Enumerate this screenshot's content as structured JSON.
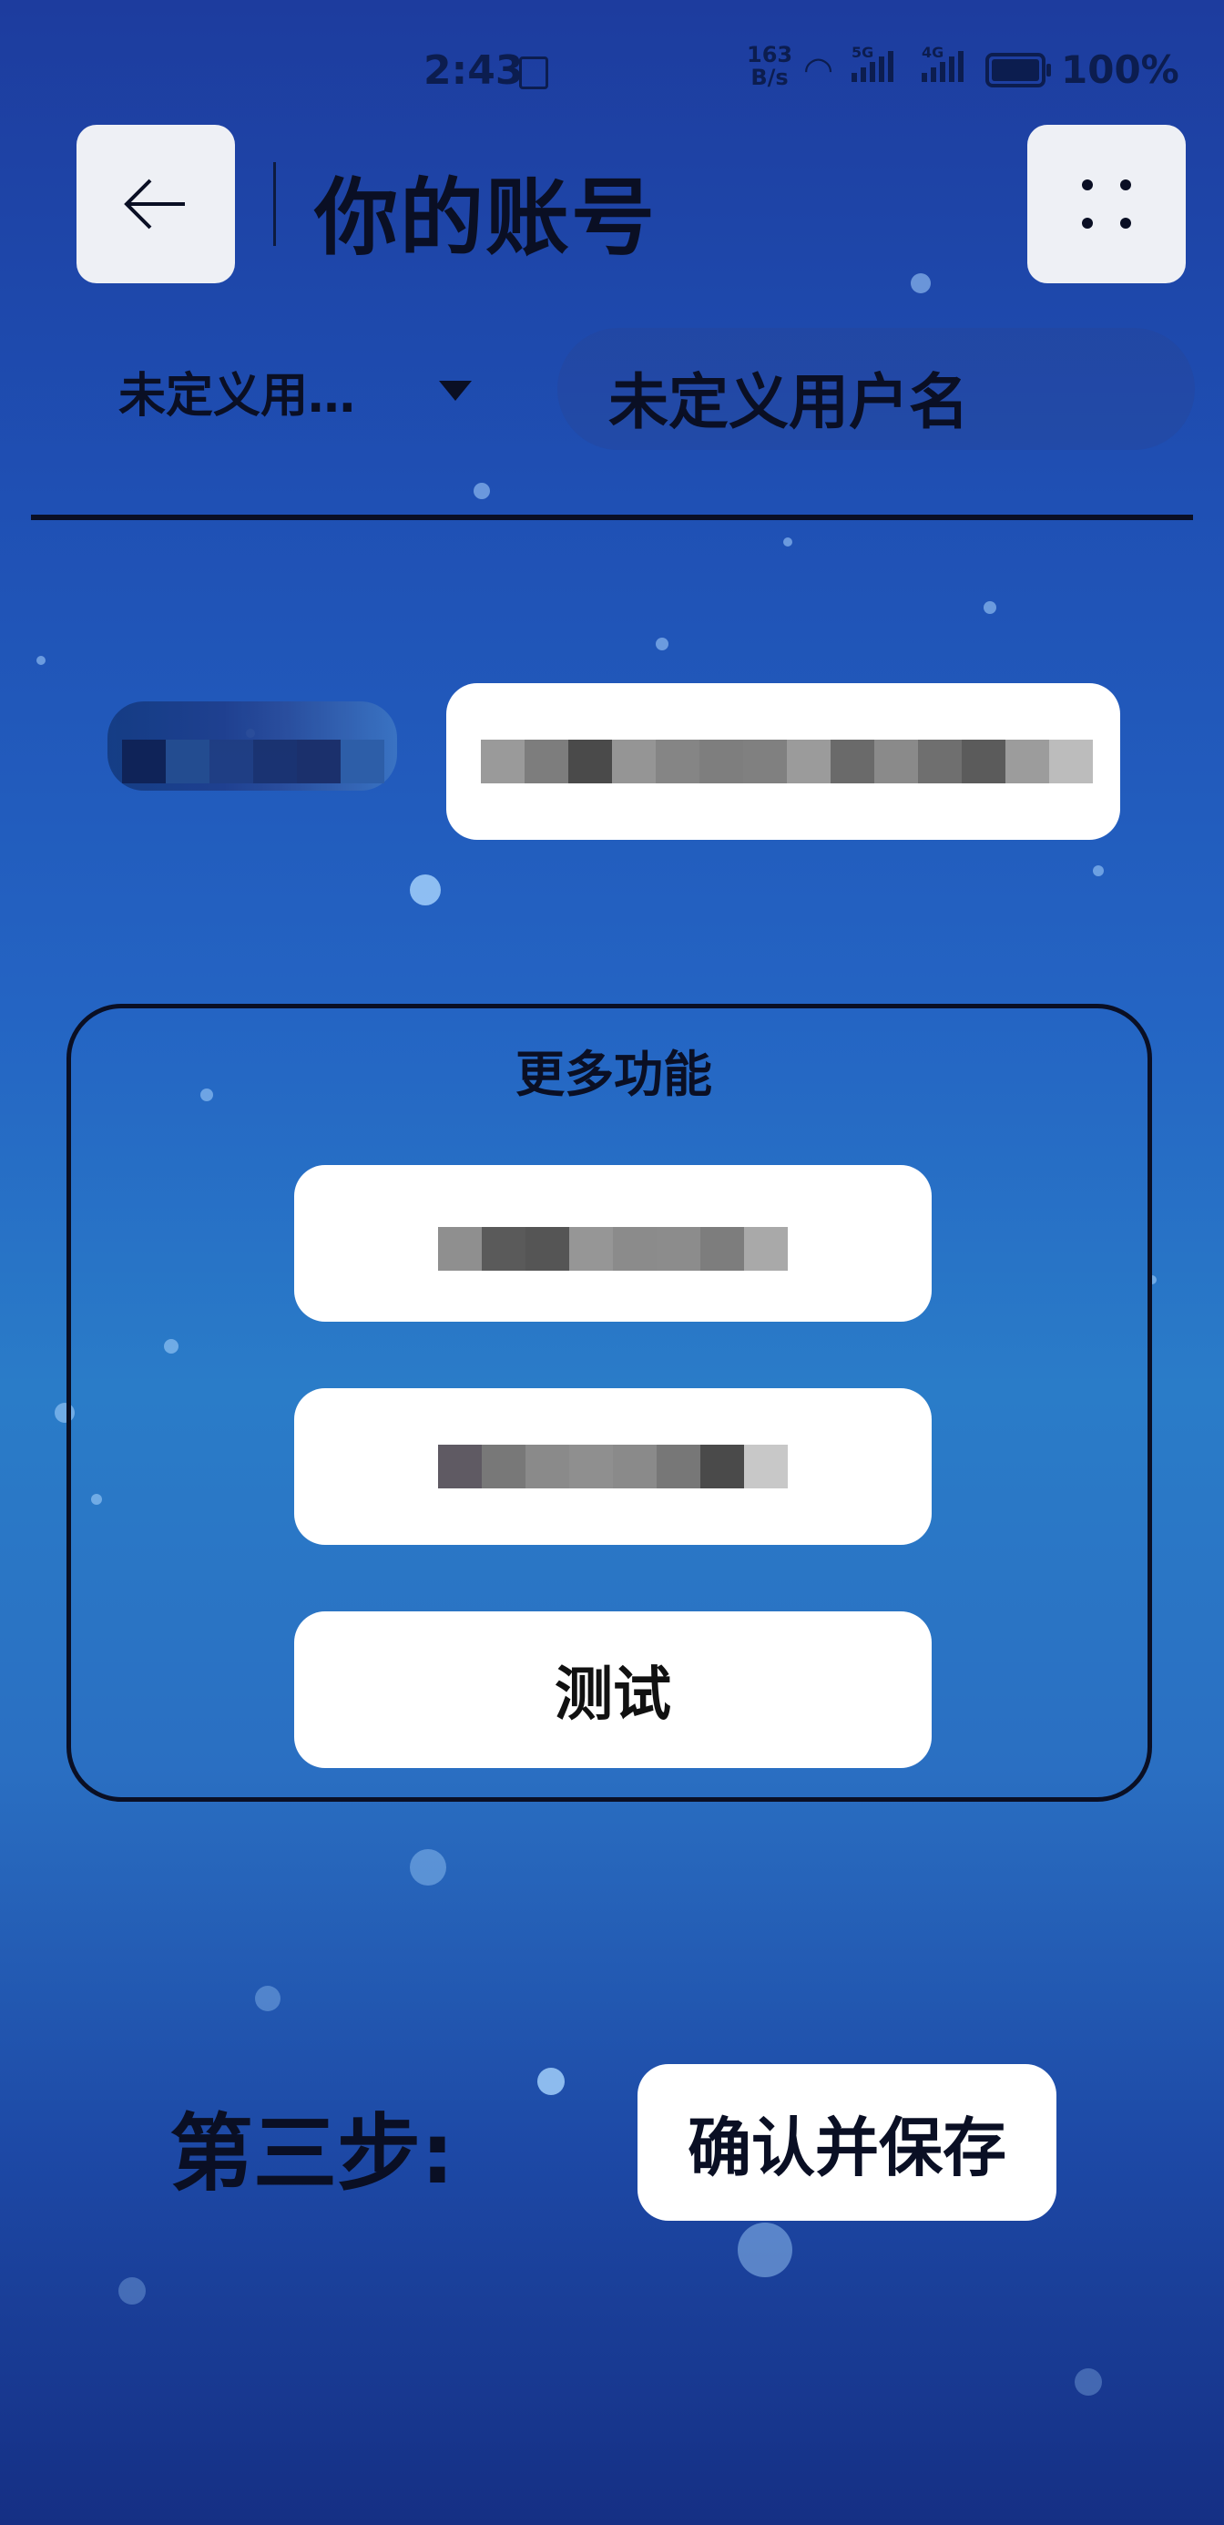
{
  "status_bar": {
    "time": "2:43",
    "net_speed_value": "163",
    "net_speed_unit": "B/s",
    "signal1_tag": "5G",
    "signal2_tag": "4G",
    "battery": "100%"
  },
  "header": {
    "back_icon": "arrow-left-icon",
    "title": "你的账号",
    "menu_icon": "four-dots-icon"
  },
  "user": {
    "selected_account": "未定义用…",
    "username_display": "未定义用户名"
  },
  "more_features": {
    "title": "更多功能",
    "buttons": [
      {
        "label": ""
      },
      {
        "label": ""
      },
      {
        "label": "测试"
      }
    ]
  },
  "step3": {
    "label": "第三步:",
    "save_button": "确认并保存"
  },
  "colors": {
    "background_top": "#1d3c9e",
    "background_mid": "#2a7cc8",
    "text_dark": "#0a0f24",
    "button_bg": "#ffffff"
  }
}
